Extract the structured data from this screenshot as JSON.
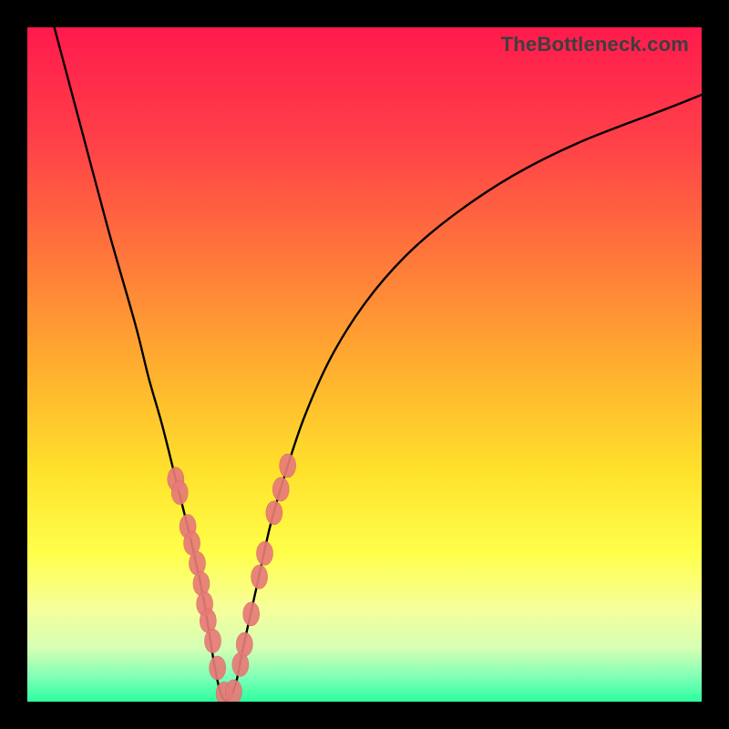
{
  "watermark": "TheBottleneck.com",
  "colors": {
    "frame": "#000000",
    "curve": "#000000",
    "marker_fill": "#e77b78",
    "marker_stroke": "#d96a67",
    "gradient_stops": [
      {
        "offset": 0.0,
        "color": "#ff1a4d"
      },
      {
        "offset": 0.18,
        "color": "#ff4348"
      },
      {
        "offset": 0.35,
        "color": "#ff7a3a"
      },
      {
        "offset": 0.52,
        "color": "#ffb42e"
      },
      {
        "offset": 0.66,
        "color": "#ffe22c"
      },
      {
        "offset": 0.78,
        "color": "#ffff4a"
      },
      {
        "offset": 0.86,
        "color": "#f7ff9a"
      },
      {
        "offset": 0.92,
        "color": "#d6ffb4"
      },
      {
        "offset": 0.965,
        "color": "#7dffb6"
      },
      {
        "offset": 1.0,
        "color": "#2cff9e"
      }
    ]
  },
  "chart_data": {
    "type": "line",
    "title": "",
    "xlabel": "",
    "ylabel": "",
    "xlim": [
      0,
      100
    ],
    "ylim": [
      0,
      100
    ],
    "grid": false,
    "legend": false,
    "notes": "V-shaped bottleneck curve; y≈0 at minimum near x≈29, rising steeply on both sides toward 100.",
    "series": [
      {
        "name": "bottleneck-curve",
        "x": [
          4,
          8,
          12,
          16,
          18,
          20,
          22,
          24,
          26,
          27,
          28,
          29,
          30,
          31,
          32,
          34,
          36,
          38,
          41,
          45,
          50,
          56,
          63,
          72,
          82,
          95,
          100
        ],
        "y": [
          100,
          85,
          70,
          56,
          48,
          41,
          33,
          25,
          16,
          10,
          4,
          0.5,
          0.5,
          3,
          8,
          17,
          26,
          33,
          42,
          51,
          59,
          66,
          72,
          78,
          83,
          88,
          90
        ]
      }
    ],
    "markers": {
      "name": "highlight-points",
      "x": [
        22.0,
        22.6,
        23.8,
        24.4,
        25.2,
        25.8,
        26.3,
        26.8,
        27.5,
        28.2,
        29.2,
        30.6,
        31.6,
        32.2,
        33.2,
        34.4,
        35.2,
        36.6,
        37.6,
        38.6
      ],
      "y": [
        33.0,
        31.0,
        26.0,
        23.5,
        20.5,
        17.5,
        14.5,
        12.0,
        9.0,
        5.0,
        1.2,
        1.5,
        5.5,
        8.5,
        13.0,
        18.5,
        22.0,
        28.0,
        31.5,
        35.0
      ]
    }
  }
}
